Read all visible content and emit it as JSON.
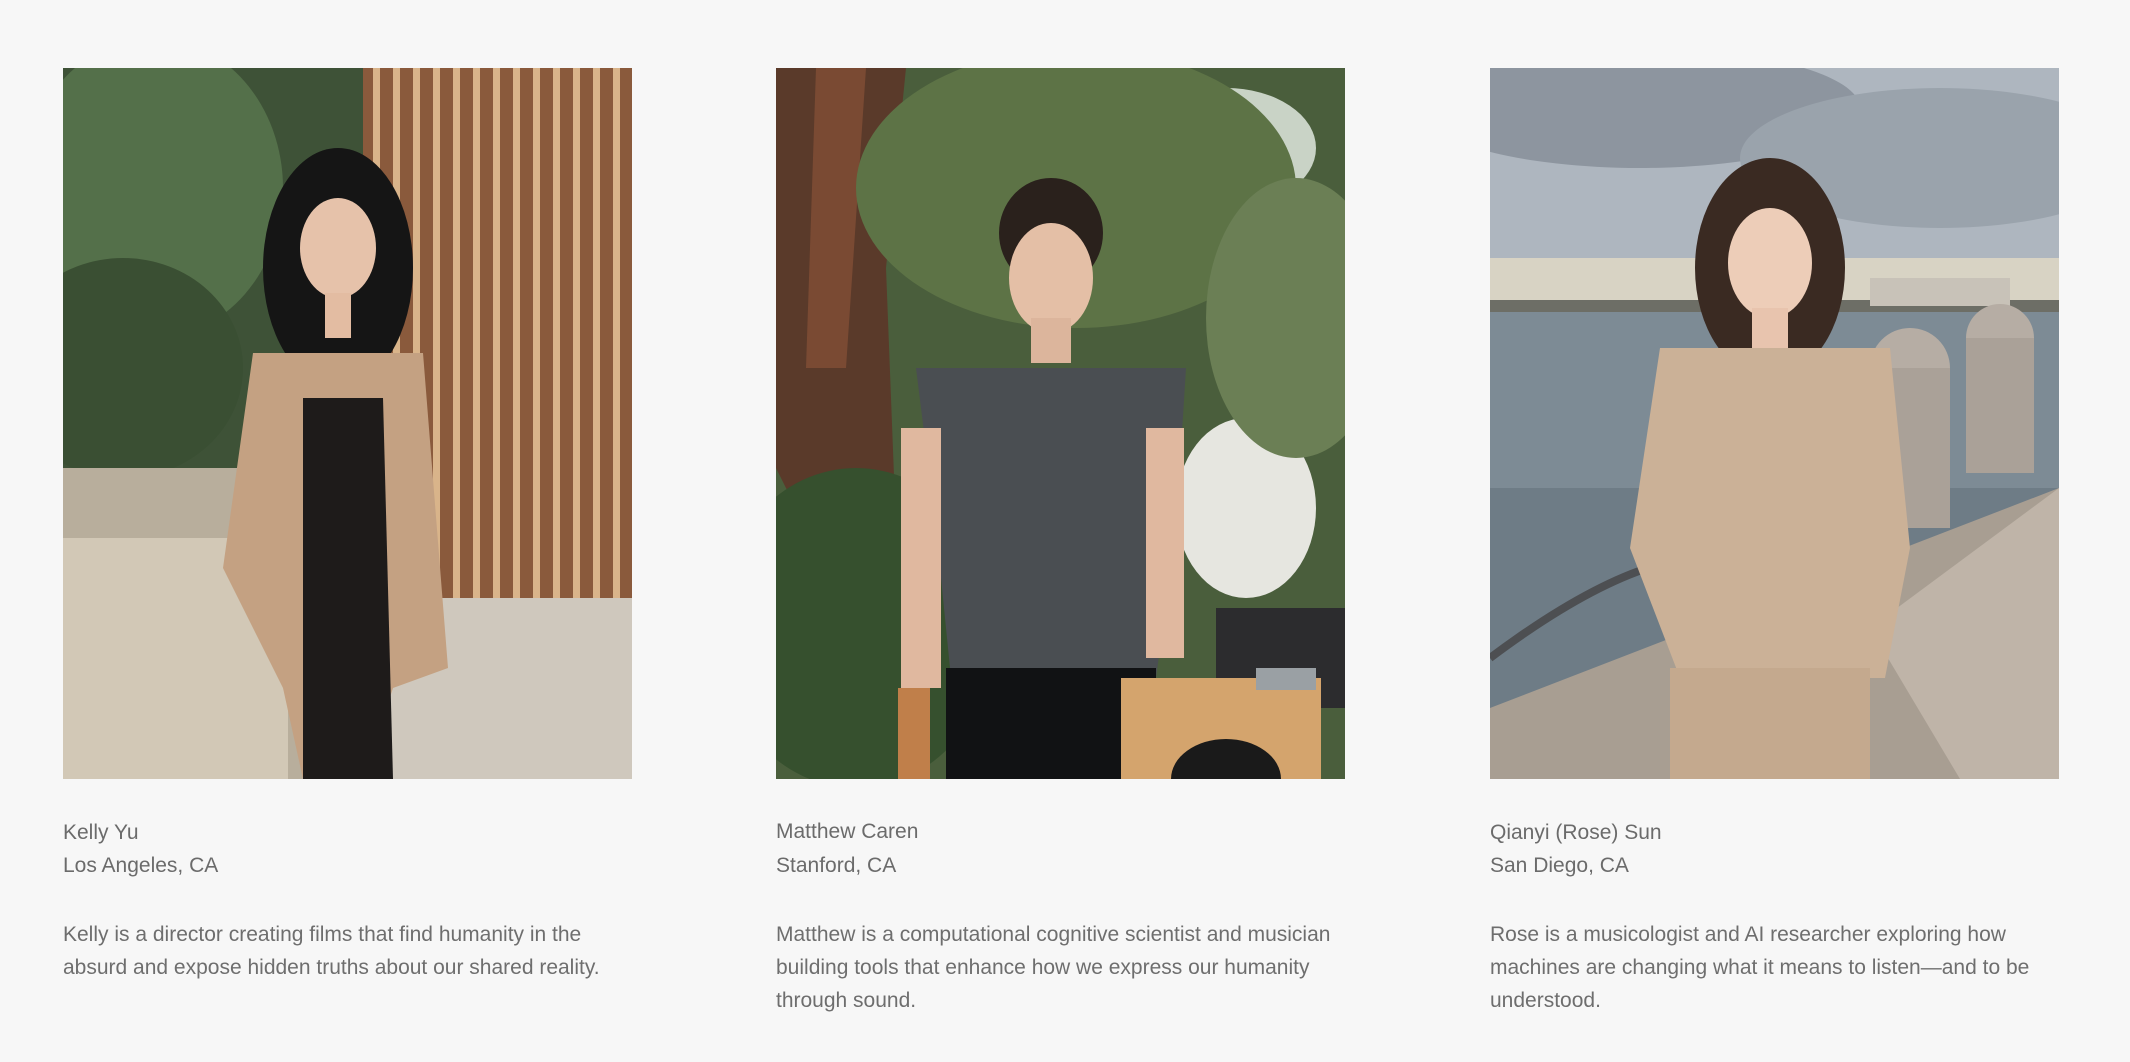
{
  "people": [
    {
      "name": "Kelly Yu",
      "location": "Los Angeles, CA",
      "bio": "Kelly is a director creating films that find humanity in the absurd and expose hidden truths about our shared reality."
    },
    {
      "name": "Matthew Caren",
      "location": "Stanford, CA",
      "bio": "Matthew is a computational cognitive scientist and musician building tools that enhance how we express our humanity through sound."
    },
    {
      "name": "Qianyi (Rose) Sun",
      "location": "San Diego, CA",
      "bio": "Rose is a musicologist and AI researcher exploring how machines are changing what it means to listen—and to be understood."
    }
  ],
  "colors": {
    "background": "#f7f7f7",
    "text": "#6e6e6e"
  }
}
